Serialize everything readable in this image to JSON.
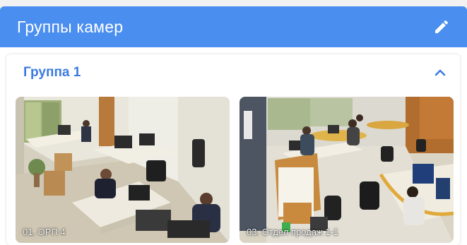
{
  "header": {
    "title": "Группы камер",
    "accent": "#4a8ef0",
    "edit_icon": "pencil-icon"
  },
  "group": {
    "title": "Группа 1",
    "expanded": true,
    "toggle_icon": "chevron-up-icon",
    "title_color": "#3a7be0"
  },
  "cameras": [
    {
      "label": "01. ОРП 4"
    },
    {
      "label": "03. Отдел продаж 1-1"
    }
  ]
}
